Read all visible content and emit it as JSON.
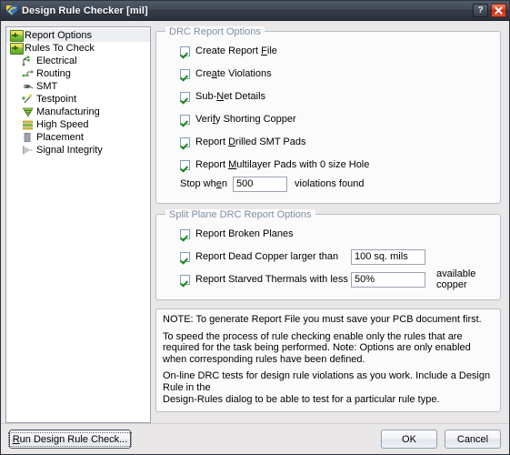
{
  "window": {
    "title": "Design Rule Checker [mil]",
    "app_icon": "altium-pcb-icon",
    "help_button": "?",
    "close_button": "✕",
    "accent_close": "#d93b20",
    "titlebar_color": "#414956",
    "check_color": "#1a8a1a",
    "legend_color": "#7f8fa4"
  },
  "sidebar": {
    "items": [
      {
        "label": "Report Options",
        "icon": "folder-icon",
        "level": 0,
        "selected": true
      },
      {
        "label": "Rules To Check",
        "icon": "folder-icon",
        "level": 0,
        "selected": false
      },
      {
        "label": "Electrical",
        "icon": "electrical-icon",
        "level": 1,
        "selected": false
      },
      {
        "label": "Routing",
        "icon": "routing-icon",
        "level": 1,
        "selected": false
      },
      {
        "label": "SMT",
        "icon": "smt-icon",
        "level": 1,
        "selected": false
      },
      {
        "label": "Testpoint",
        "icon": "testpoint-icon",
        "level": 1,
        "selected": false
      },
      {
        "label": "Manufacturing",
        "icon": "manufacturing-icon",
        "level": 1,
        "selected": false
      },
      {
        "label": "High Speed",
        "icon": "high-speed-icon",
        "level": 1,
        "selected": false
      },
      {
        "label": "Placement",
        "icon": "placement-icon",
        "level": 1,
        "selected": false
      },
      {
        "label": "Signal Integrity",
        "icon": "signal-integrity-icon",
        "level": 1,
        "selected": false
      }
    ]
  },
  "drc_report_options": {
    "legend": "DRC Report Options",
    "checkboxes": [
      {
        "label": "Create Report File",
        "accel": "F",
        "checked": true
      },
      {
        "label": "Create Violations",
        "accel": "a",
        "checked": true
      },
      {
        "label": "Sub-Net Details",
        "accel": "N",
        "checked": true
      },
      {
        "label": "Verify Shorting Copper",
        "accel": "f",
        "checked": true
      },
      {
        "label": "Report Drilled SMT Pads",
        "accel": "D",
        "checked": true
      },
      {
        "label": "Report Multilayer Pads with 0 size Hole",
        "accel": "M",
        "checked": true
      }
    ],
    "stop_when": {
      "prefix": "Stop when",
      "accel": "e",
      "value": "500",
      "suffix": "violations found"
    }
  },
  "split_plane_options": {
    "legend": "Split Plane DRC Report Options",
    "rows": [
      {
        "label": "Report Broken Planes",
        "checked": true,
        "value": null,
        "suffix": null
      },
      {
        "label": "Report Dead Copper larger than",
        "checked": true,
        "value": "100 sq. mils",
        "suffix": null
      },
      {
        "label": "Report Starved Thermals with less than",
        "checked": true,
        "value": "50%",
        "suffix": "available copper"
      }
    ]
  },
  "note": {
    "line1": "NOTE: To generate Report File you must save your PCB document first.",
    "line2": "To speed the process of rule checking enable only the rules that are required for the task being performed.  Note: Options are only enabled when corresponding rules have been defined.",
    "line3": "On-line DRC tests for design rule violations as you work. Include a Design Rule in the",
    "line4": "Design-Rules dialog to be able to test for a particular rule  type."
  },
  "footer": {
    "run_label": "Run Design Rule Check...",
    "run_accel": "R",
    "ok_label": "OK",
    "cancel_label": "Cancel"
  }
}
